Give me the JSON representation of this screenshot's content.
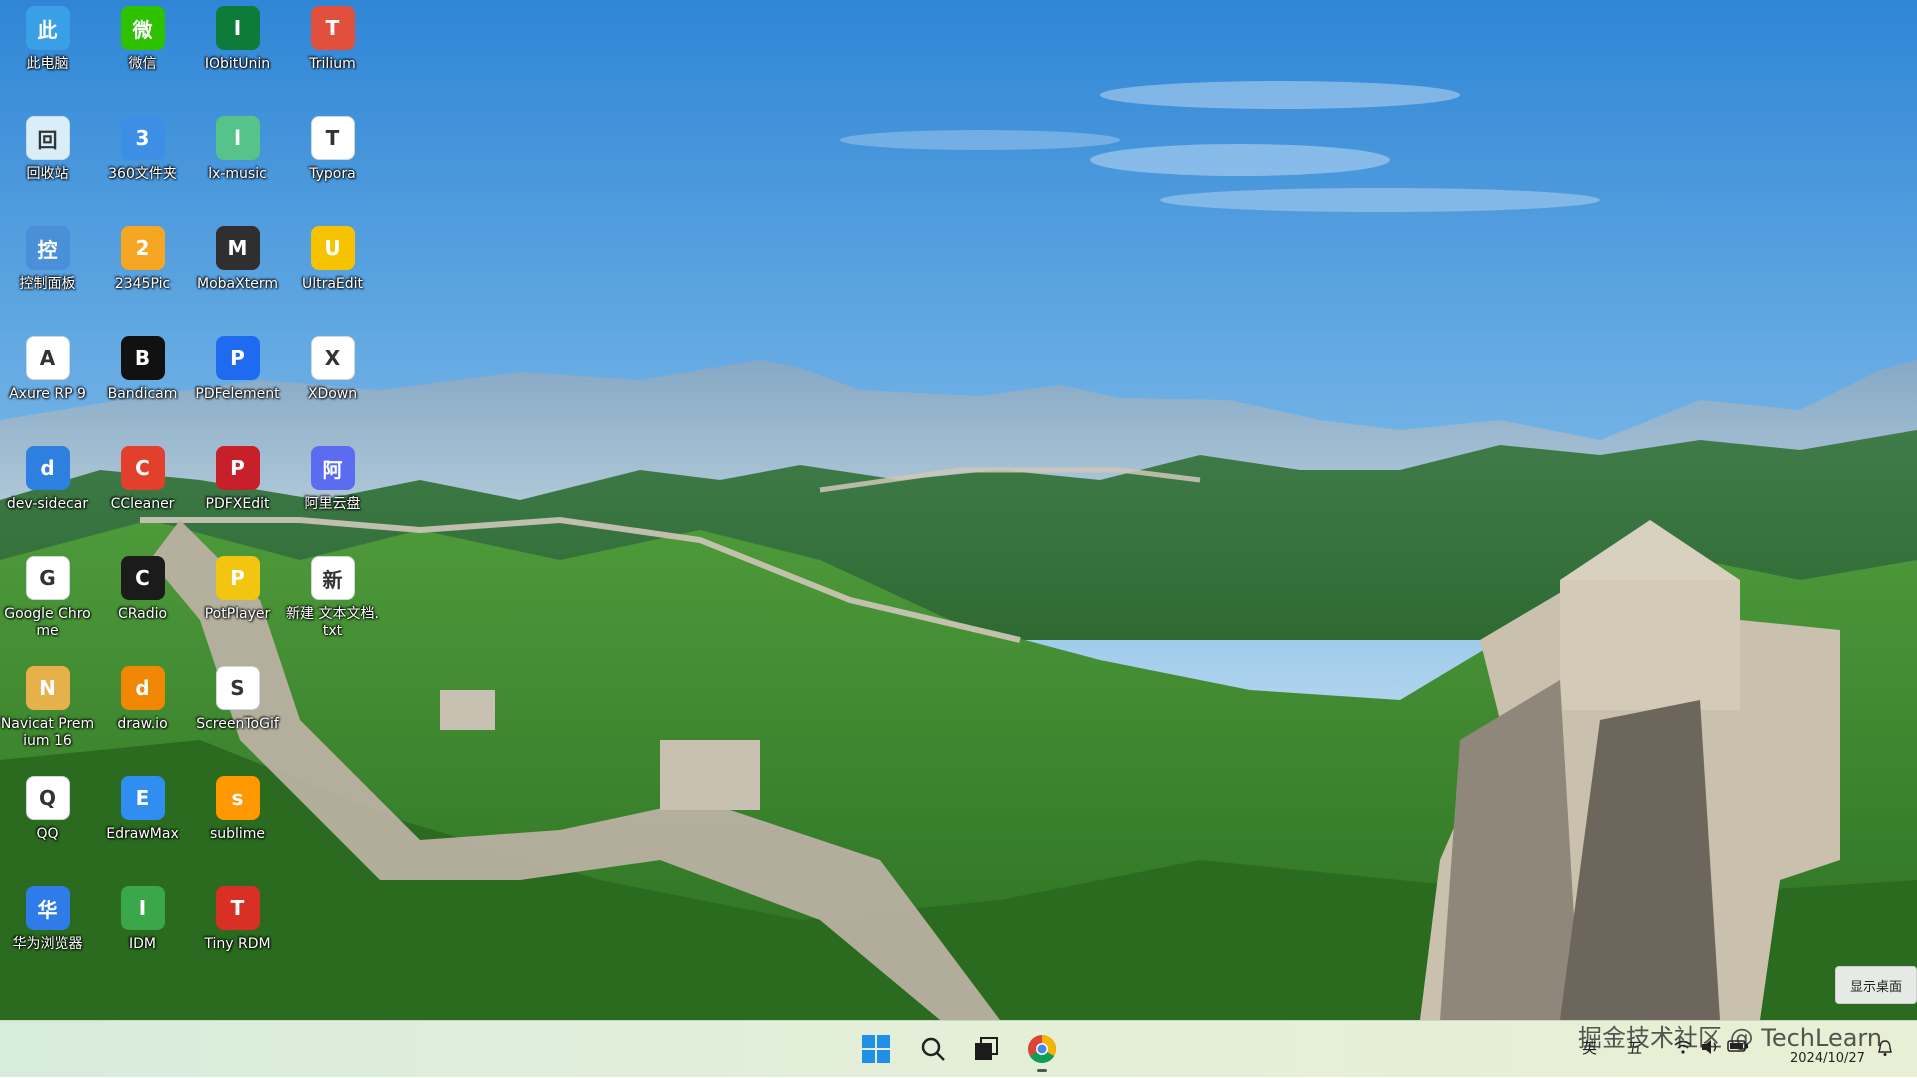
{
  "desktop": {
    "icons": [
      {
        "label": "此电脑",
        "icon": "computer-icon",
        "color": "#3aa0e6"
      },
      {
        "label": "微信",
        "icon": "wechat-icon",
        "color": "#2dc100"
      },
      {
        "label": "IObitUnin",
        "icon": "iobit-uninstaller-icon",
        "color": "#0d7c3a"
      },
      {
        "label": "Trilium",
        "icon": "trilium-icon",
        "color": "#e0503c"
      },
      {
        "label": "回收站",
        "icon": "recycle-bin-icon",
        "color": "#d8eef8"
      },
      {
        "label": "360文件夹",
        "icon": "folder-360-icon",
        "color": "#3d8fe6"
      },
      {
        "label": "lx-music",
        "icon": "lx-music-icon",
        "color": "#56c48a"
      },
      {
        "label": "Typora",
        "icon": "typora-icon",
        "color": "#ffffff"
      },
      {
        "label": "控制面板",
        "icon": "control-panel-icon",
        "color": "#4a90d9"
      },
      {
        "label": "2345Pic",
        "icon": "2345pic-icon",
        "color": "#f5a623"
      },
      {
        "label": "MobaXterm",
        "icon": "mobaxterm-icon",
        "color": "#2f2f2f"
      },
      {
        "label": "UltraEdit",
        "icon": "ultraedit-icon",
        "color": "#f5c300"
      },
      {
        "label": "Axure RP 9",
        "icon": "axure-icon",
        "color": "#ffffff"
      },
      {
        "label": "Bandicam",
        "icon": "bandicam-icon",
        "color": "#111111"
      },
      {
        "label": "PDFelement",
        "icon": "pdfelement-icon",
        "color": "#1e6bf0"
      },
      {
        "label": "XDown",
        "icon": "xdown-icon",
        "color": "#ffffff"
      },
      {
        "label": "dev-sidecar",
        "icon": "dev-sidecar-icon",
        "color": "#2d7fe0"
      },
      {
        "label": "CCleaner",
        "icon": "ccleaner-icon",
        "color": "#e2402c"
      },
      {
        "label": "PDFXEdit",
        "icon": "pdfxedit-icon",
        "color": "#c8202a"
      },
      {
        "label": "阿里云盘",
        "icon": "aliyun-drive-icon",
        "color": "#5b6cf0"
      },
      {
        "label": "Google Chrome",
        "icon": "chrome-icon",
        "color": "#ffffff"
      },
      {
        "label": "CRadio",
        "icon": "cradio-icon",
        "color": "#1b1b1b"
      },
      {
        "label": "PotPlayer",
        "icon": "potplayer-icon",
        "color": "#f2c511"
      },
      {
        "label": "新建 文本文档.txt",
        "icon": "text-file-icon",
        "color": "#ffffff"
      },
      {
        "label": "Navicat Premium 16",
        "icon": "navicat-icon",
        "color": "#e6b04a"
      },
      {
        "label": "draw.io",
        "icon": "drawio-icon",
        "color": "#f08705"
      },
      {
        "label": "ScreenToGif",
        "icon": "screentogif-icon",
        "color": "#ffffff"
      },
      {
        "label": "",
        "icon": "blank-slot",
        "color": ""
      },
      {
        "label": "QQ",
        "icon": "qq-icon",
        "color": "#ffffff"
      },
      {
        "label": "EdrawMax",
        "icon": "edrawmax-icon",
        "color": "#2f8ef0"
      },
      {
        "label": "sublime",
        "icon": "sublime-icon",
        "color": "#ff9800"
      },
      {
        "label": "",
        "icon": "blank-slot",
        "color": ""
      },
      {
        "label": "华为浏览器",
        "icon": "huawei-browser-icon",
        "color": "#2f7be8"
      },
      {
        "label": "IDM",
        "icon": "idm-icon",
        "color": "#3aa84a"
      },
      {
        "label": "Tiny RDM",
        "icon": "tiny-rdm-icon",
        "color": "#d93025"
      }
    ]
  },
  "show_desktop_tip": "显示桌面",
  "taskbar": {
    "pinned": [
      {
        "name": "start",
        "icon": "windows-start-icon"
      },
      {
        "name": "search",
        "icon": "search-icon"
      },
      {
        "name": "task-view",
        "icon": "task-view-icon"
      },
      {
        "name": "chrome",
        "icon": "chrome-icon"
      }
    ],
    "tray": {
      "ime_lang": "英",
      "ime_mode": "五",
      "date": "2024/10/27"
    }
  },
  "watermark": "掘金技术社区 @ TechLearn"
}
